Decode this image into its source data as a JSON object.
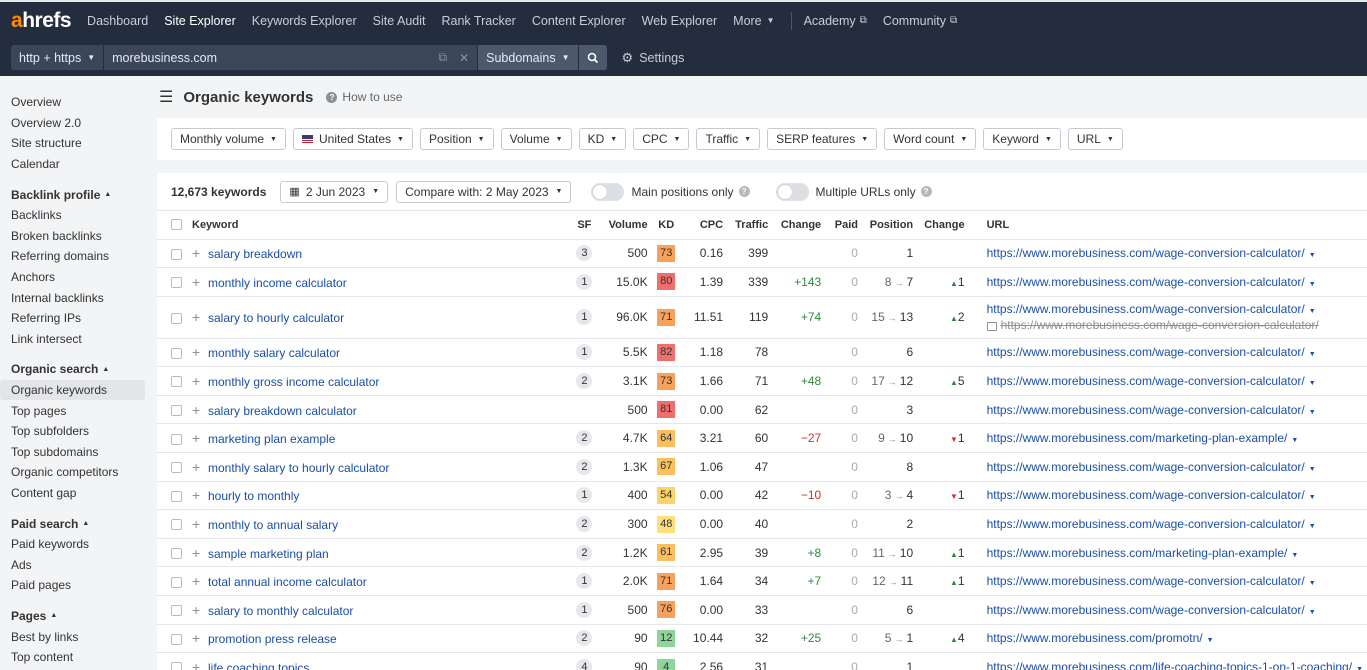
{
  "nav": {
    "logo_a": "a",
    "logo_rest": "hrefs",
    "items": [
      "Dashboard",
      "Site Explorer",
      "Keywords Explorer",
      "Site Audit",
      "Rank Tracker",
      "Content Explorer",
      "Web Explorer",
      "More"
    ],
    "academy": "Academy",
    "community": "Community"
  },
  "search": {
    "protocol": "http + https",
    "url": "morebusiness.com",
    "mode": "Subdomains",
    "settings": "Settings"
  },
  "sidebar": {
    "top_items": [
      "Overview",
      "Overview 2.0",
      "Site structure",
      "Calendar"
    ],
    "backlink_head": "Backlink profile",
    "backlink_items": [
      "Backlinks",
      "Broken backlinks",
      "Referring domains",
      "Anchors",
      "Internal backlinks",
      "Referring IPs",
      "Link intersect"
    ],
    "organic_head": "Organic search",
    "organic_items": [
      "Organic keywords",
      "Top pages",
      "Top subfolders",
      "Top subdomains",
      "Organic competitors",
      "Content gap"
    ],
    "paid_head": "Paid search",
    "paid_items": [
      "Paid keywords",
      "Ads",
      "Paid pages"
    ],
    "pages_head": "Pages",
    "pages_items": [
      "Best by links",
      "Top content"
    ]
  },
  "header": {
    "title": "Organic keywords",
    "howto": "How to use"
  },
  "filters": [
    "Monthly volume",
    "United States",
    "Position",
    "Volume",
    "KD",
    "CPC",
    "Traffic",
    "SERP features",
    "Word count",
    "Keyword",
    "URL"
  ],
  "toolbar": {
    "count": "12,673 keywords",
    "date": "2 Jun 2023",
    "compare": "Compare with: 2 May 2023",
    "main_positions": "Main positions only",
    "multiple_urls": "Multiple URLs only"
  },
  "columns": [
    "Keyword",
    "SF",
    "Volume",
    "KD",
    "CPC",
    "Traffic",
    "Change",
    "Paid",
    "Position",
    "Change",
    "URL"
  ],
  "rows": [
    {
      "kw": "salary breakdown",
      "sf": "3",
      "vol": "500",
      "kd": "73",
      "kdcolor": "#f7a25c",
      "cpc": "0.16",
      "traffic": "399",
      "chg": "",
      "paid": "0",
      "pos_from": "",
      "pos": "1",
      "pchg": "",
      "pdir": "",
      "url": "https://www.morebusiness.com/wage-conversion-calculator/"
    },
    {
      "kw": "monthly income calculator",
      "sf": "1",
      "vol": "15.0K",
      "kd": "80",
      "kdcolor": "#ef6f6c",
      "cpc": "1.39",
      "traffic": "339",
      "chg": "+143",
      "paid": "0",
      "pos_from": "8",
      "pos": "7",
      "pchg": "1",
      "pdir": "up",
      "url": "https://www.morebusiness.com/wage-conversion-calculator/"
    },
    {
      "kw": "salary to hourly calculator",
      "sf": "1",
      "vol": "96.0K",
      "kd": "71",
      "kdcolor": "#f7a25c",
      "cpc": "11.51",
      "traffic": "119",
      "chg": "+74",
      "paid": "0",
      "pos_from": "15",
      "pos": "13",
      "pchg": "2",
      "pdir": "up",
      "url": "https://www.morebusiness.com/wage-conversion-calculator/",
      "url2": "https://www.morebusiness.com/wage-conversion-calculator/"
    },
    {
      "kw": "monthly salary calculator",
      "sf": "1",
      "vol": "5.5K",
      "kd": "82",
      "kdcolor": "#ef6f6c",
      "cpc": "1.18",
      "traffic": "78",
      "chg": "",
      "paid": "0",
      "pos_from": "",
      "pos": "6",
      "pchg": "",
      "pdir": "",
      "url": "https://www.morebusiness.com/wage-conversion-calculator/"
    },
    {
      "kw": "monthly gross income calculator",
      "sf": "2",
      "vol": "3.1K",
      "kd": "73",
      "kdcolor": "#f7a25c",
      "cpc": "1.66",
      "traffic": "71",
      "chg": "+48",
      "paid": "0",
      "pos_from": "17",
      "pos": "12",
      "pchg": "5",
      "pdir": "up",
      "url": "https://www.morebusiness.com/wage-conversion-calculator/"
    },
    {
      "kw": "salary breakdown calculator",
      "sf": "",
      "vol": "500",
      "kd": "81",
      "kdcolor": "#ef6f6c",
      "cpc": "0.00",
      "traffic": "62",
      "chg": "",
      "paid": "0",
      "pos_from": "",
      "pos": "3",
      "pchg": "",
      "pdir": "",
      "url": "https://www.morebusiness.com/wage-conversion-calculator/"
    },
    {
      "kw": "marketing plan example",
      "sf": "2",
      "vol": "4.7K",
      "kd": "64",
      "kdcolor": "#fbbf5e",
      "cpc": "3.21",
      "traffic": "60",
      "chg": "−27",
      "paid": "0",
      "pos_from": "9",
      "pos": "10",
      "pchg": "1",
      "pdir": "down",
      "url": "https://www.morebusiness.com/marketing-plan-example/"
    },
    {
      "kw": "monthly salary to hourly calculator",
      "sf": "2",
      "vol": "1.3K",
      "kd": "67",
      "kdcolor": "#fbbf5e",
      "cpc": "1.06",
      "traffic": "47",
      "chg": "",
      "paid": "0",
      "pos_from": "",
      "pos": "8",
      "pchg": "",
      "pdir": "",
      "url": "https://www.morebusiness.com/wage-conversion-calculator/"
    },
    {
      "kw": "hourly to monthly",
      "sf": "1",
      "vol": "400",
      "kd": "54",
      "kdcolor": "#fcd36b",
      "cpc": "0.00",
      "traffic": "42",
      "chg": "−10",
      "paid": "0",
      "pos_from": "3",
      "pos": "4",
      "pchg": "1",
      "pdir": "down",
      "url": "https://www.morebusiness.com/wage-conversion-calculator/"
    },
    {
      "kw": "monthly to annual salary",
      "sf": "2",
      "vol": "300",
      "kd": "48",
      "kdcolor": "#fde07c",
      "cpc": "0.00",
      "traffic": "40",
      "chg": "",
      "paid": "0",
      "pos_from": "",
      "pos": "2",
      "pchg": "",
      "pdir": "",
      "url": "https://www.morebusiness.com/wage-conversion-calculator/"
    },
    {
      "kw": "sample marketing plan",
      "sf": "2",
      "vol": "1.2K",
      "kd": "61",
      "kdcolor": "#fbbf5e",
      "cpc": "2.95",
      "traffic": "39",
      "chg": "+8",
      "paid": "0",
      "pos_from": "11",
      "pos": "10",
      "pchg": "1",
      "pdir": "up",
      "url": "https://www.morebusiness.com/marketing-plan-example/"
    },
    {
      "kw": "total annual income calculator",
      "sf": "1",
      "vol": "2.0K",
      "kd": "71",
      "kdcolor": "#f7a25c",
      "cpc": "1.64",
      "traffic": "34",
      "chg": "+7",
      "paid": "0",
      "pos_from": "12",
      "pos": "11",
      "pchg": "1",
      "pdir": "up",
      "url": "https://www.morebusiness.com/wage-conversion-calculator/"
    },
    {
      "kw": "salary to monthly calculator",
      "sf": "1",
      "vol": "500",
      "kd": "76",
      "kdcolor": "#f7a25c",
      "cpc": "0.00",
      "traffic": "33",
      "chg": "",
      "paid": "0",
      "pos_from": "",
      "pos": "6",
      "pchg": "",
      "pdir": "",
      "url": "https://www.morebusiness.com/wage-conversion-calculator/"
    },
    {
      "kw": "promotion press release",
      "sf": "2",
      "vol": "90",
      "kd": "12",
      "kdcolor": "#8fd49a",
      "cpc": "10.44",
      "traffic": "32",
      "chg": "+25",
      "paid": "0",
      "pos_from": "5",
      "pos": "1",
      "pchg": "4",
      "pdir": "up",
      "url": "https://www.morebusiness.com/promotn/"
    },
    {
      "kw": "life coaching topics",
      "sf": "4",
      "vol": "90",
      "kd": "4",
      "kdcolor": "#8fd49a",
      "cpc": "2.56",
      "traffic": "31",
      "chg": "",
      "paid": "0",
      "pos_from": "",
      "pos": "1",
      "pchg": "",
      "pdir": "",
      "url": "https://www.morebusiness.com/life-coaching-topics-1-on-1-coaching/"
    }
  ]
}
